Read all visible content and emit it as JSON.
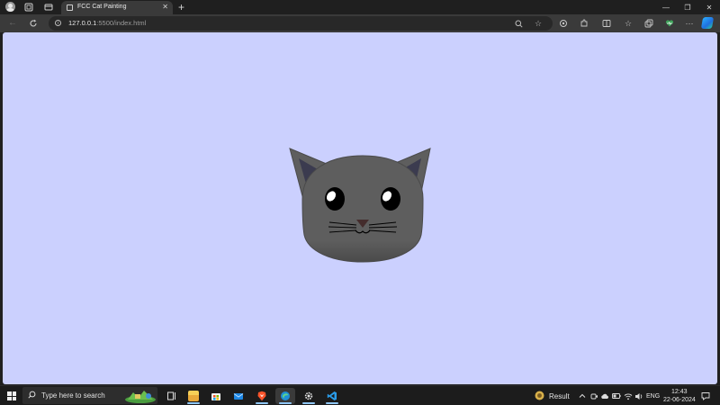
{
  "browser": {
    "tab": {
      "title": "FCC Cat Painting",
      "close_glyph": "✕"
    },
    "new_tab_glyph": "+",
    "window_controls": {
      "minimize": "—",
      "maximize": "❐",
      "close": "✕"
    },
    "address": {
      "host": "127.0.0.1",
      "path": ":5500/index.html"
    },
    "icons": {
      "back": "back-arrow-icon",
      "refresh": "refresh-icon",
      "info": "site-info-icon",
      "zoom": "zoom-icon",
      "favorite": "star-icon",
      "extension": "extension-icon",
      "split": "split-screen-icon",
      "favorites": "favorites-icon",
      "collections": "collections-icon",
      "browser_essentials": "heart-pulse-icon",
      "more": "more-icon",
      "copilot": "copilot-icon"
    }
  },
  "page": {
    "background_color": "#cbd0fe",
    "cat": {
      "head_color": "#5e5e5e",
      "ear_color": "#5e5e5e",
      "inner_ear_color": "#3b3b4f",
      "eye_color": "#000000",
      "nose_color": "#442c2c"
    }
  },
  "taskbar": {
    "search_placeholder": "Type here to search",
    "weather_label": "Result",
    "language": "ENG",
    "time": "12:43",
    "date": "22-06-2024"
  }
}
